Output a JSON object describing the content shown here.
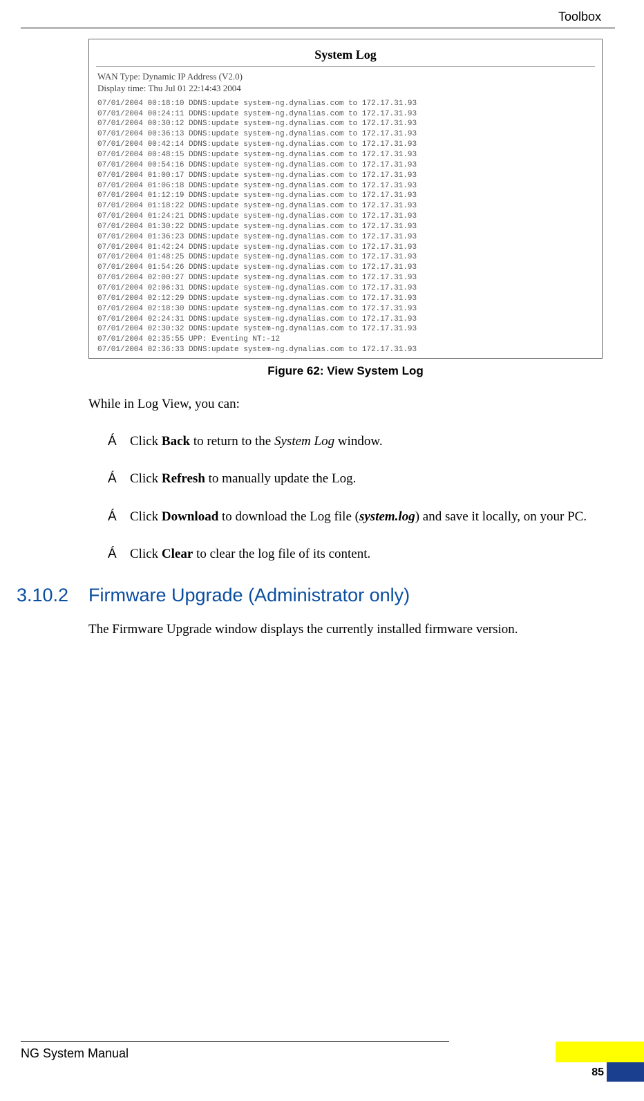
{
  "header": {
    "label": "Toolbox"
  },
  "figure": {
    "title": "System Log",
    "wan_type": "WAN Type: Dynamic IP Address (V2.0)",
    "display_time": "Display time: Thu Jul 01 22:14:43 2004",
    "entries": [
      "07/01/2004 00:18:10 DDNS:update system-ng.dynalias.com to 172.17.31.93",
      "07/01/2004 00:24:11 DDNS:update system-ng.dynalias.com to 172.17.31.93",
      "07/01/2004 00:30:12 DDNS:update system-ng.dynalias.com to 172.17.31.93",
      "07/01/2004 00:36:13 DDNS:update system-ng.dynalias.com to 172.17.31.93",
      "07/01/2004 00:42:14 DDNS:update system-ng.dynalias.com to 172.17.31.93",
      "07/01/2004 00:48:15 DDNS:update system-ng.dynalias.com to 172.17.31.93",
      "07/01/2004 00:54:16 DDNS:update system-ng.dynalias.com to 172.17.31.93",
      "07/01/2004 01:00:17 DDNS:update system-ng.dynalias.com to 172.17.31.93",
      "07/01/2004 01:06:18 DDNS:update system-ng.dynalias.com to 172.17.31.93",
      "07/01/2004 01:12:19 DDNS:update system-ng.dynalias.com to 172.17.31.93",
      "07/01/2004 01:18:22 DDNS:update system-ng.dynalias.com to 172.17.31.93",
      "07/01/2004 01:24:21 DDNS:update system-ng.dynalias.com to 172.17.31.93",
      "07/01/2004 01:30:22 DDNS:update system-ng.dynalias.com to 172.17.31.93",
      "07/01/2004 01:36:23 DDNS:update system-ng.dynalias.com to 172.17.31.93",
      "07/01/2004 01:42:24 DDNS:update system-ng.dynalias.com to 172.17.31.93",
      "07/01/2004 01:48:25 DDNS:update system-ng.dynalias.com to 172.17.31.93",
      "07/01/2004 01:54:26 DDNS:update system-ng.dynalias.com to 172.17.31.93",
      "07/01/2004 02:00:27 DDNS:update system-ng.dynalias.com to 172.17.31.93",
      "07/01/2004 02:06:31 DDNS:update system-ng.dynalias.com to 172.17.31.93",
      "07/01/2004 02:12:29 DDNS:update system-ng.dynalias.com to 172.17.31.93",
      "07/01/2004 02:18:30 DDNS:update system-ng.dynalias.com to 172.17.31.93",
      "07/01/2004 02:24:31 DDNS:update system-ng.dynalias.com to 172.17.31.93",
      "07/01/2004 02:30:32 DDNS:update system-ng.dynalias.com to 172.17.31.93",
      "07/01/2004 02:35:55 UPP: Eventing NT:-12",
      "07/01/2004 02:36:33 DDNS:update system-ng.dynalias.com to 172.17.31.93"
    ],
    "caption": "Figure 62: View System Log"
  },
  "intro": "While in Log View, you can:",
  "bullet_mark": "Á",
  "bullets": [
    {
      "pre": "Click ",
      "bold": "Back",
      "mid": " to return to the ",
      "ital": "System Log",
      "post": " window."
    },
    {
      "pre": "Click ",
      "bold": "Refresh",
      "post": " to manually update the Log."
    },
    {
      "pre": "Click ",
      "bold": "Download",
      "mid": " to download the Log file (",
      "bital": "system.log",
      "post": ") and save it locally, on your PC."
    },
    {
      "pre": "Click ",
      "bold": "Clear",
      "post": " to clear the log file of its content."
    }
  ],
  "section": {
    "number": "3.10.2",
    "title": "Firmware Upgrade (Administrator only)"
  },
  "section_body": "The Firmware Upgrade window displays the currently installed firmware version.",
  "footer": {
    "label": "NG System Manual",
    "page": "85"
  }
}
